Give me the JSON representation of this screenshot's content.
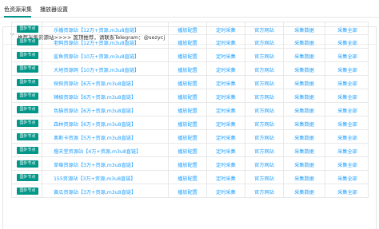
{
  "tabs": [
    {
      "label": "色资源采集"
    },
    {
      "label": "播放器设置"
    }
  ],
  "panel": {
    "header": "推荐采集资源站>>>> 置顶推荐，请联系Telegram：@sezycj"
  },
  "colors": {
    "accent": "#009688",
    "link": "#1e9fff",
    "border": "#e8e8e8"
  },
  "icons": {
    "collapse": "chevron-down-icon"
  },
  "rows": [
    {
      "badge": "国外节点",
      "name": "乐播资源站【12万+资源,m3u8直链】",
      "actions": [
        "播放配置",
        "定时采集",
        "官方网站",
        "采集数据",
        "采集全部"
      ]
    },
    {
      "badge": "国外节点",
      "name": "老鸭资源站【12万+资源,m3u8直链】",
      "actions": [
        "播放配置",
        "定时采集",
        "官方网站",
        "采集数据",
        "采集全部"
      ]
    },
    {
      "badge": "国外节点",
      "name": "鲨鱼资源站【10万+资源,m3u8直链】",
      "actions": [
        "播放配置",
        "定时采集",
        "官方网站",
        "采集数据",
        "采集全部"
      ]
    },
    {
      "badge": "国外节点",
      "name": "大地资源网【10万+资源,m3u8直链】",
      "actions": [
        "播放配置",
        "定时采集",
        "官方网站",
        "采集数据",
        "采集全部"
      ]
    },
    {
      "badge": "国外节点",
      "name": "探探资源站【6万+资源,m3u8直链】",
      "actions": [
        "播放配置",
        "定时采集",
        "官方网站",
        "采集数据",
        "采集全部"
      ]
    },
    {
      "badge": "国外节点",
      "name": "辣椒资源站【6万+资源,m3u8直链】",
      "actions": [
        "播放配置",
        "定时采集",
        "官方网站",
        "采集数据",
        "采集全部"
      ]
    },
    {
      "badge": "国外节点",
      "name": "色猫资源站【6万+资源,m3u8直链】",
      "actions": [
        "播放配置",
        "定时采集",
        "官方网站",
        "采集数据",
        "采集全部"
      ]
    },
    {
      "badge": "国外节点",
      "name": "森林资源站【6万+资源,m3u8直链】",
      "actions": [
        "播放配置",
        "定时采集",
        "官方网站",
        "采集数据",
        "采集全部"
      ]
    },
    {
      "badge": "国外节点",
      "name": "奥斯卡资源【5万+资源,m3u8直链】",
      "actions": [
        "播放配置",
        "定时采集",
        "官方网站",
        "采集数据",
        "采集全部"
      ]
    },
    {
      "badge": "国外节点",
      "name": "撸天堂资源站【4万+资源,m3u8直链】",
      "actions": [
        "播放配置",
        "定时采集",
        "官方网站",
        "采集数据",
        "采集全部"
      ]
    },
    {
      "badge": "国外节点",
      "name": "草莓资源站【3万+资源,m3u8直链】",
      "actions": [
        "播放配置",
        "定时采集",
        "官方网站",
        "采集数据",
        "采集全部"
      ]
    },
    {
      "badge": "国外节点",
      "name": "155资源站【3万+资源,m3u8直链】",
      "actions": [
        "播放配置",
        "定时采集",
        "官方网站",
        "采集数据",
        "采集全部"
      ]
    },
    {
      "badge": "国外节点",
      "name": "黄瓜资源站【3万+资源,m3u8直链】",
      "actions": [
        "播放配置",
        "定时采集",
        "官方网站",
        "采集数据",
        "采集全部"
      ]
    }
  ]
}
